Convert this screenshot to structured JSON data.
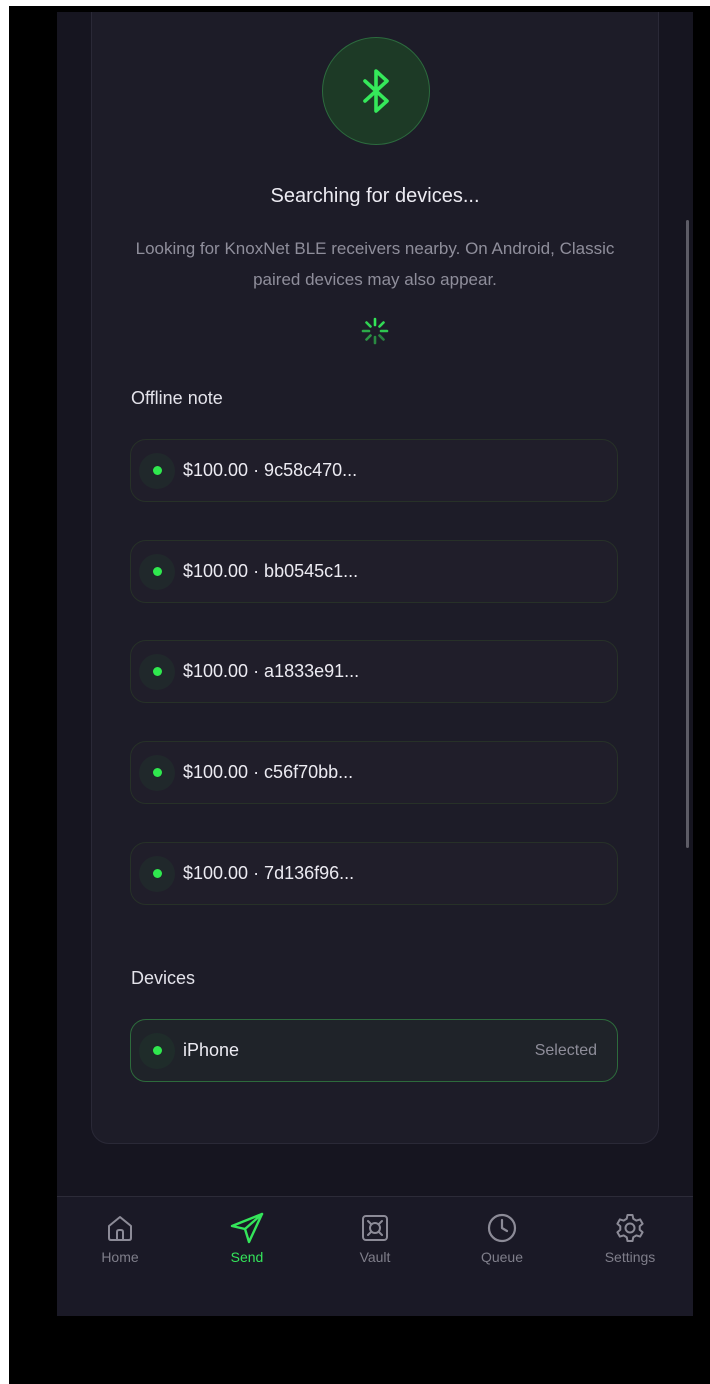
{
  "scan": {
    "title": "Searching for devices...",
    "description": "Looking for KnoxNet BLE receivers nearby. On Android, Classic paired devices may also appear."
  },
  "notes": {
    "heading": "Offline note",
    "items": [
      {
        "label": "$100.00 · 9c58c470..."
      },
      {
        "label": "$100.00 · bb0545c1..."
      },
      {
        "label": "$100.00 · a1833e91..."
      },
      {
        "label": "$100.00 · c56f70bb..."
      },
      {
        "label": "$100.00 · 7d136f96..."
      }
    ]
  },
  "devices": {
    "heading": "Devices",
    "items": [
      {
        "label": "iPhone",
        "status": "Selected"
      }
    ]
  },
  "tabbar": {
    "items": [
      {
        "label": "Home",
        "icon": "home-icon"
      },
      {
        "label": "Send",
        "icon": "send-icon",
        "active": true
      },
      {
        "label": "Vault",
        "icon": "vault-icon"
      },
      {
        "label": "Queue",
        "icon": "clock-icon"
      },
      {
        "label": "Settings",
        "icon": "gear-icon"
      }
    ]
  },
  "colors": {
    "accent": "#2fe84e",
    "background": "#161520",
    "card": "#1d1c28"
  }
}
